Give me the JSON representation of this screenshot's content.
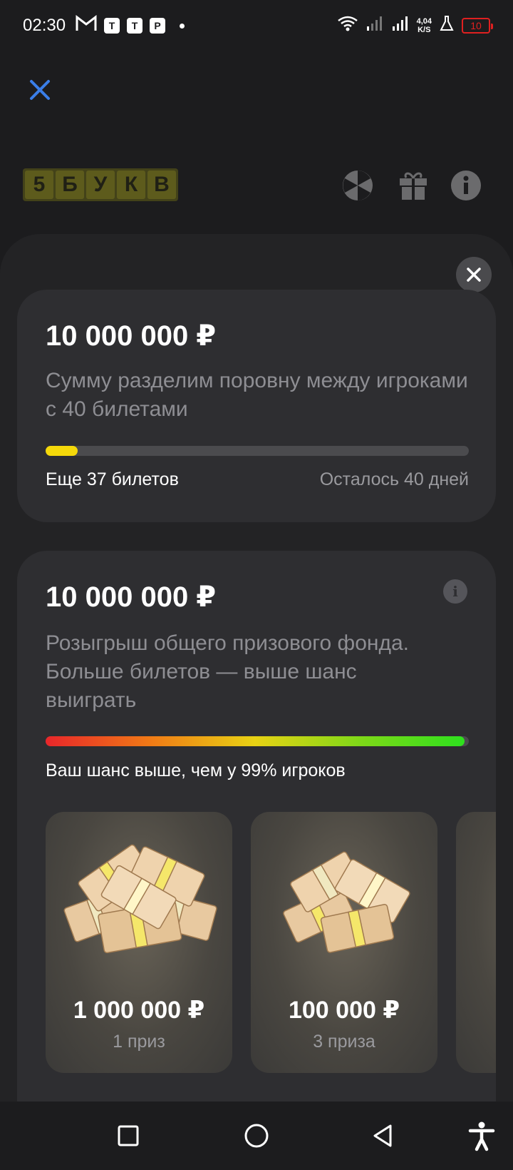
{
  "status_bar": {
    "time": "02:30",
    "app_icons": [
      "M",
      "T",
      "T",
      "P"
    ],
    "speed_top": "4,04",
    "speed_bottom": "K/S",
    "battery": "10"
  },
  "game": {
    "logo_letters": [
      "5",
      "Б",
      "У",
      "К",
      "В"
    ]
  },
  "pool_card": {
    "amount": "10 000 000 ₽",
    "description": "Сумму разделим поровну между игроками с 40 билетами",
    "progress_fraction": 0.075,
    "remaining_tickets": "Еще 37 билетов",
    "days_left": "Осталось 40 дней"
  },
  "draw_card": {
    "amount": "10 000 000 ₽",
    "description": "Розыгрыш общего призового фонда. Больше билетов — выше шанс выиграть",
    "chance_fraction": 0.99,
    "chance_text": "Ваш шанс выше, чем у 99% игроков",
    "prizes": [
      {
        "amount": "1 000 000 ₽",
        "count": "1 приз"
      },
      {
        "amount": "100 000 ₽",
        "count": "3 приза"
      }
    ]
  },
  "colors": {
    "background": "#1c1c1e",
    "card": "#2e2e31",
    "accent_yellow": "#f5d90a",
    "close_blue": "#3a7ee8"
  }
}
